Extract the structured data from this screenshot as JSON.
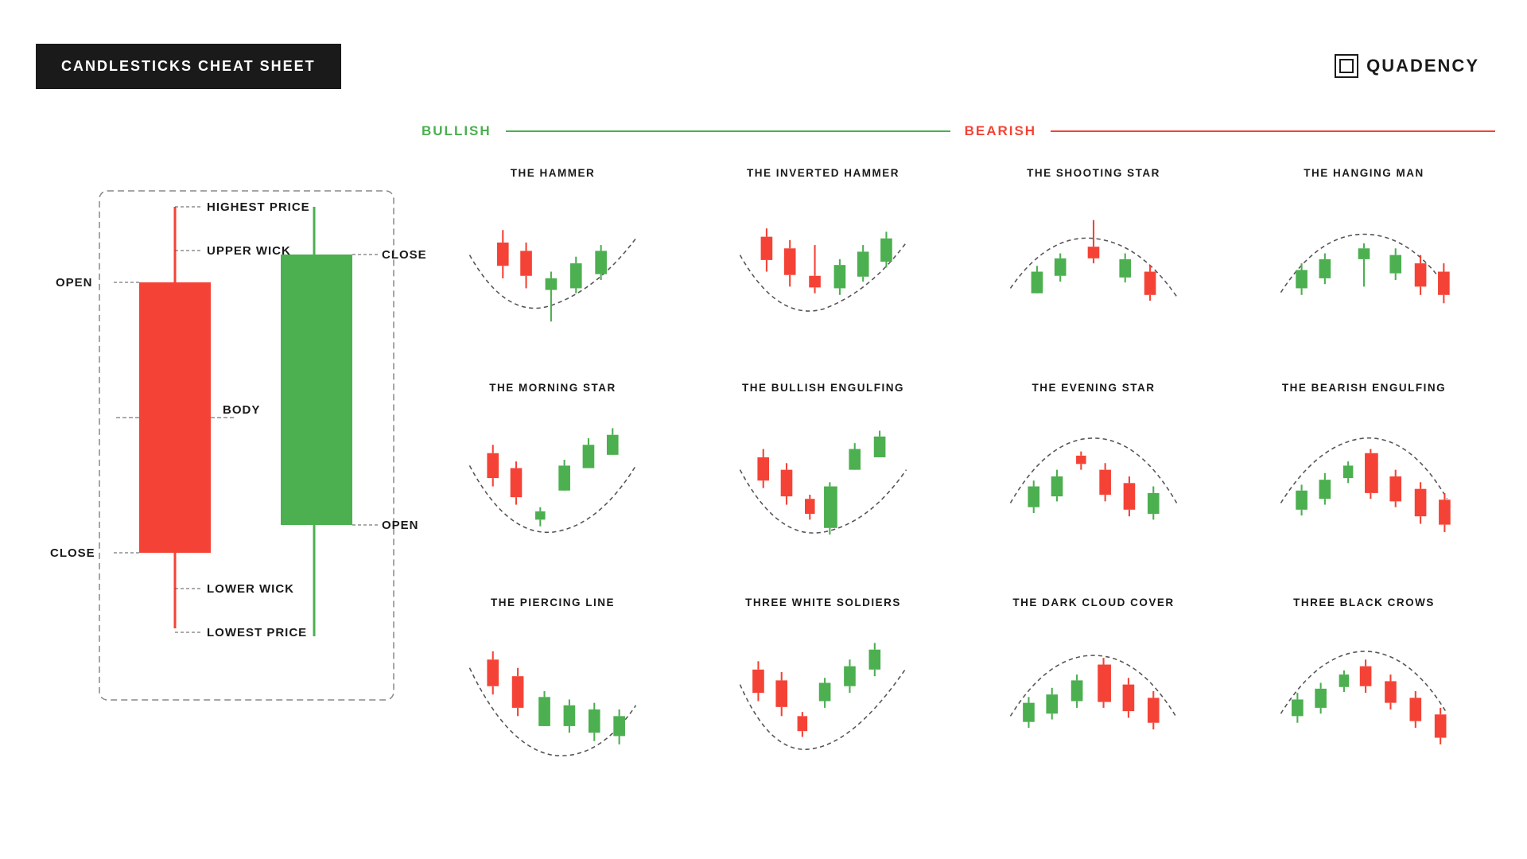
{
  "header": {
    "title": "CANDLESTICKS CHEAT SHEET",
    "logo": "QUADENCY"
  },
  "diagram": {
    "labels": {
      "open_left": "OPEN",
      "close_left": "CLOSE",
      "highest_price": "HIGHEST PRICE",
      "upper_wick": "UPPER WICK",
      "body": "BODY",
      "lower_wick": "LOWER WICK",
      "lowest_price": "LOWEST PRICE",
      "close_right": "CLOSE",
      "open_right": "OPEN"
    }
  },
  "categories": {
    "bullish": "BULLISH",
    "bearish": "BEARISH"
  },
  "patterns": [
    {
      "id": "hammer",
      "title": "THE HAMMER",
      "type": "bullish"
    },
    {
      "id": "inverted-hammer",
      "title": "THE INVERTED HAMMER",
      "type": "bullish"
    },
    {
      "id": "shooting-star",
      "title": "THE SHOOTING STAR",
      "type": "bearish"
    },
    {
      "id": "hanging-man",
      "title": "THE HANGING MAN",
      "type": "bearish"
    },
    {
      "id": "morning-star",
      "title": "THE MORNING STAR",
      "type": "bullish"
    },
    {
      "id": "bullish-engulfing",
      "title": "THE BULLISH ENGULFING",
      "type": "bullish"
    },
    {
      "id": "evening-star",
      "title": "THE EVENING STAR",
      "type": "bearish"
    },
    {
      "id": "bearish-engulfing",
      "title": "THE BEARISH ENGULFING",
      "type": "bearish"
    },
    {
      "id": "piercing-line",
      "title": "THE PIERCING LINE",
      "type": "bullish"
    },
    {
      "id": "three-white-soldiers",
      "title": "THREE WHITE SOLDIERS",
      "type": "bullish"
    },
    {
      "id": "dark-cloud-cover",
      "title": "THE DARK CLOUD COVER",
      "type": "bearish"
    },
    {
      "id": "three-black-crows",
      "title": "THREE BLACK CROWS",
      "type": "bearish"
    }
  ]
}
